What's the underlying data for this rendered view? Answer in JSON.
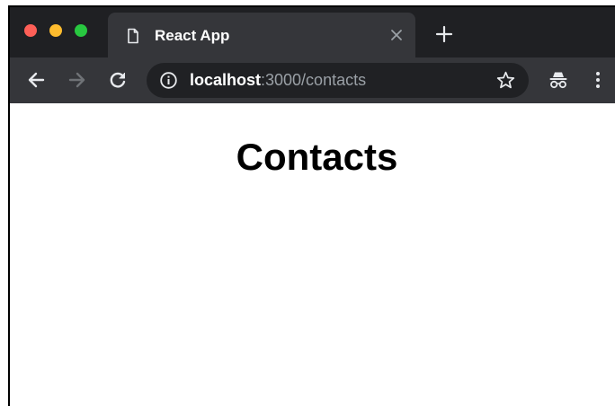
{
  "browser": {
    "tab": {
      "title": "React App",
      "icon": "document-icon"
    },
    "new_tab_icon": "plus-icon",
    "toolbar": {
      "back_icon": "arrow-left-icon",
      "forward_icon": "arrow-right-icon",
      "reload_icon": "reload-icon"
    },
    "address_bar": {
      "security_icon": "info-icon",
      "host": "localhost",
      "path": ":3000/contacts",
      "bookmark_icon": "star-icon"
    },
    "profile_icon": "incognito-icon",
    "menu_icon": "vertical-dots-icon",
    "traffic_lights": {
      "close_color": "#fe5f57",
      "minimize_color": "#febc2e",
      "maximize_color": "#28c840"
    }
  },
  "page": {
    "heading": "Contacts"
  }
}
